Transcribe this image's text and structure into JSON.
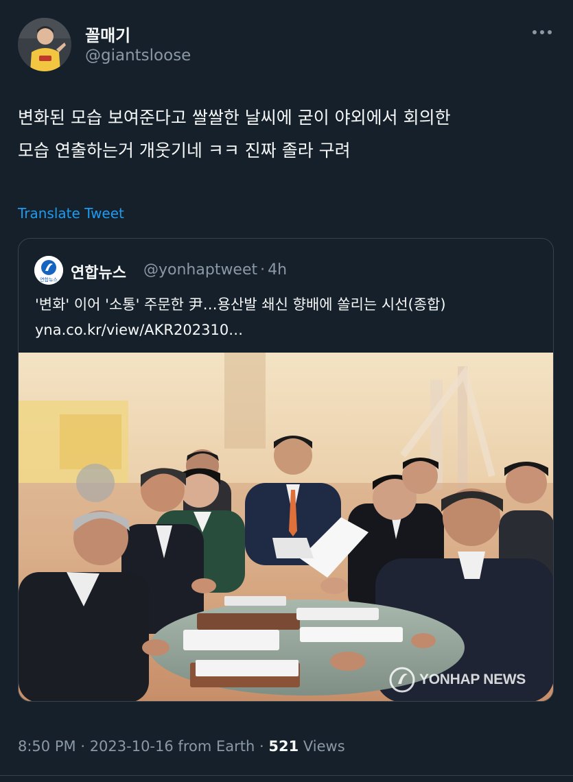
{
  "tweet": {
    "author": {
      "display_name": "꼴매기",
      "handle": "@giantsloose",
      "avatar_icon": "user-avatar"
    },
    "more_icon": "more-horizontal-icon",
    "text_lines": [
      "변화된 모습 보여준다고 쌀쌀한 날씨에 굳이 야외에서 회의한",
      "모습 연출하는거 개웃기네 ㅋㅋ 진짜 졸라 구려"
    ],
    "translate_label": "Translate Tweet",
    "meta": {
      "time": "8:50 PM",
      "date": "2023-10-16",
      "source": "from Earth",
      "views_count": "521",
      "views_label": "Views",
      "separator": "·"
    }
  },
  "quoted": {
    "name": "연합뉴스",
    "handle": "@yonhaptweet",
    "age": "4h",
    "logo_text": "연합뉴스",
    "text_lines": [
      "'변화' 이어 '소통' 주문한 尹…용산발 쇄신 향배에 쏠리는 시선(종합)",
      "yna.co.kr/view/AKR202310…"
    ],
    "photo": {
      "watermark": "YONHAP NEWS"
    }
  },
  "colors": {
    "background": "#15202b",
    "text_primary": "#f7f9f9",
    "text_secondary": "#8b98a5",
    "link": "#1d9bf0",
    "border": "#38444d"
  }
}
